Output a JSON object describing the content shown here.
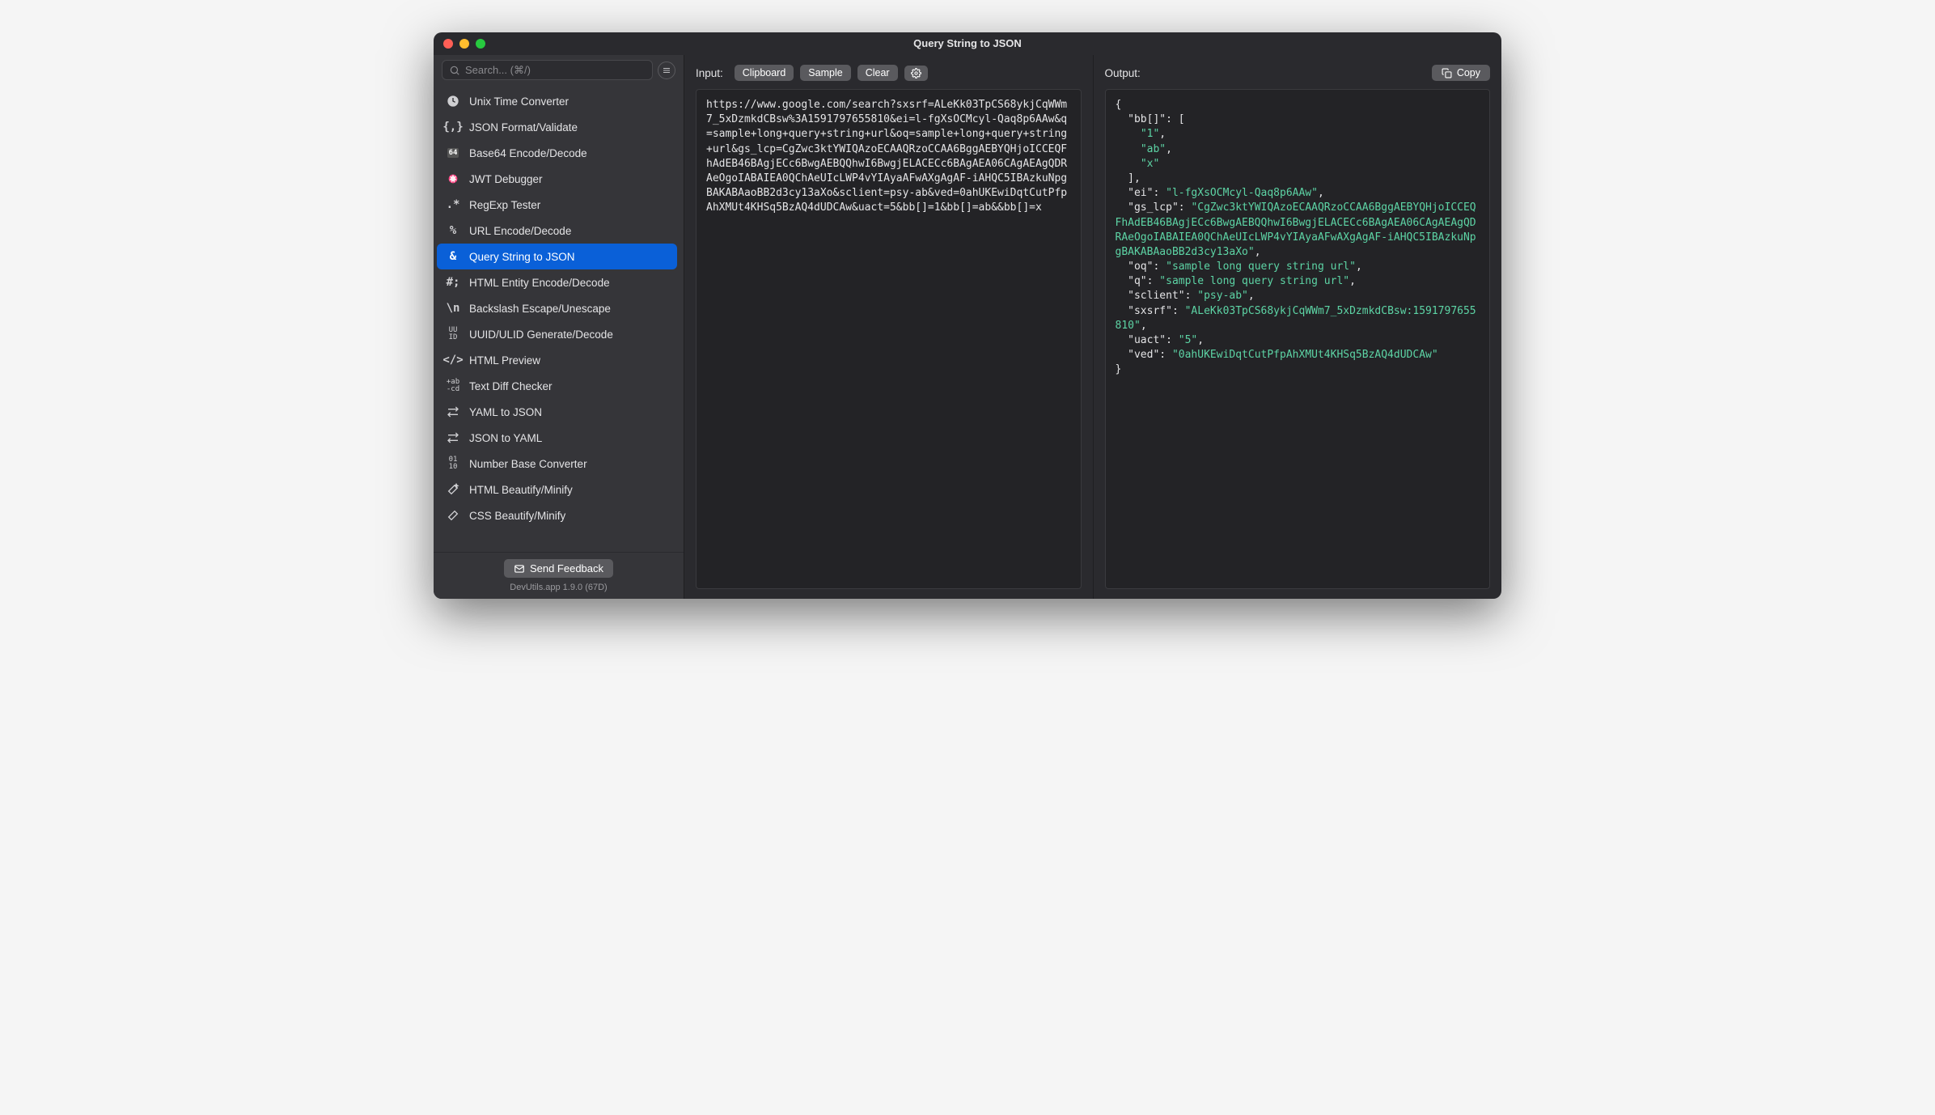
{
  "title": "Query String to JSON",
  "search": {
    "placeholder": "Search... (⌘/)"
  },
  "sidebar": {
    "tools": [
      {
        "label": "Unix Time Converter",
        "icon": "clock"
      },
      {
        "label": "JSON Format/Validate",
        "icon": "braces"
      },
      {
        "label": "Base64 Encode/Decode",
        "icon": "b64"
      },
      {
        "label": "JWT Debugger",
        "icon": "jwt"
      },
      {
        "label": "RegExp Tester",
        "icon": "regex"
      },
      {
        "label": "URL Encode/Decode",
        "icon": "percent"
      },
      {
        "label": "Query String to JSON",
        "icon": "amp",
        "active": true
      },
      {
        "label": "HTML Entity Encode/Decode",
        "icon": "hash"
      },
      {
        "label": "Backslash Escape/Unescape",
        "icon": "bslash"
      },
      {
        "label": "UUID/ULID Generate/Decode",
        "icon": "uuid"
      },
      {
        "label": "HTML Preview",
        "icon": "tag"
      },
      {
        "label": "Text Diff Checker",
        "icon": "textdiff"
      },
      {
        "label": "YAML to JSON",
        "icon": "swap"
      },
      {
        "label": "JSON to YAML",
        "icon": "swap"
      },
      {
        "label": "Number Base Converter",
        "icon": "bits"
      },
      {
        "label": "HTML Beautify/Minify",
        "icon": "wand"
      },
      {
        "label": "CSS Beautify/Minify",
        "icon": "wand2"
      }
    ],
    "feedback": "Send Feedback",
    "version": "DevUtils.app 1.9.0 (67D)"
  },
  "input": {
    "label": "Input:",
    "buttons": {
      "clipboard": "Clipboard",
      "sample": "Sample",
      "clear": "Clear"
    },
    "text": "https://www.google.com/search?sxsrf=ALeKk03TpCS68ykjCqWWm7_5xDzmkdCBsw%3A1591797655810&ei=l-fgXsOCMcyl-Qaq8p6AAw&q=sample+long+query+string+url&oq=sample+long+query+string+url&gs_lcp=CgZwc3ktYWIQAzoECAAQRzoCCAA6BggAEBYQHjoICCEQFhAdEB46BAgjECc6BwgAEBQQhwI6BwgjELACECc6BAgAEA06CAgAEAgQDRAeOgoIABAIEA0QChAeUIcLWP4vYIAyaAFwAXgAgAF-iAHQC5IBAzkuNpgBAKABAaoBB2d3cy13aXo&sclient=psy-ab&ved=0ahUKEwiDqtCutPfpAhXMUt4KHSq5BzAQ4dUDCAw&uact=5&bb[]=1&bb[]=ab&&bb[]=x"
  },
  "output": {
    "label": "Output:",
    "copy": "Copy",
    "json_tokens": [
      {
        "t": "punc",
        "v": "{\n"
      },
      {
        "t": "punc",
        "v": "  "
      },
      {
        "t": "key",
        "v": "\"bb[]\""
      },
      {
        "t": "punc",
        "v": ": [\n"
      },
      {
        "t": "punc",
        "v": "    "
      },
      {
        "t": "str",
        "v": "\"1\""
      },
      {
        "t": "punc",
        "v": ",\n"
      },
      {
        "t": "punc",
        "v": "    "
      },
      {
        "t": "str",
        "v": "\"ab\""
      },
      {
        "t": "punc",
        "v": ",\n"
      },
      {
        "t": "punc",
        "v": "    "
      },
      {
        "t": "str",
        "v": "\"x\""
      },
      {
        "t": "punc",
        "v": "\n"
      },
      {
        "t": "punc",
        "v": "  ],\n"
      },
      {
        "t": "punc",
        "v": "  "
      },
      {
        "t": "key",
        "v": "\"ei\""
      },
      {
        "t": "punc",
        "v": ": "
      },
      {
        "t": "str",
        "v": "\"l-fgXsOCMcyl-Qaq8p6AAw\""
      },
      {
        "t": "punc",
        "v": ",\n"
      },
      {
        "t": "punc",
        "v": "  "
      },
      {
        "t": "key",
        "v": "\"gs_lcp\""
      },
      {
        "t": "punc",
        "v": ": "
      },
      {
        "t": "str",
        "v": "\"CgZwc3ktYWIQAzoECAAQRzoCCAA6BggAEBYQHjoICCEQFhAdEB46BAgjECc6BwgAEBQQhwI6BwgjELACECc6BAgAEA06CAgAEAgQDRAeOgoIABAIEA0QChAeUIcLWP4vYIAyaAFwAXgAgAF-iAHQC5IBAzkuNpgBAKABAaoBB2d3cy13aXo\""
      },
      {
        "t": "punc",
        "v": ",\n"
      },
      {
        "t": "punc",
        "v": "  "
      },
      {
        "t": "key",
        "v": "\"oq\""
      },
      {
        "t": "punc",
        "v": ": "
      },
      {
        "t": "str",
        "v": "\"sample long query string url\""
      },
      {
        "t": "punc",
        "v": ",\n"
      },
      {
        "t": "punc",
        "v": "  "
      },
      {
        "t": "key",
        "v": "\"q\""
      },
      {
        "t": "punc",
        "v": ": "
      },
      {
        "t": "str",
        "v": "\"sample long query string url\""
      },
      {
        "t": "punc",
        "v": ",\n"
      },
      {
        "t": "punc",
        "v": "  "
      },
      {
        "t": "key",
        "v": "\"sclient\""
      },
      {
        "t": "punc",
        "v": ": "
      },
      {
        "t": "str",
        "v": "\"psy-ab\""
      },
      {
        "t": "punc",
        "v": ",\n"
      },
      {
        "t": "punc",
        "v": "  "
      },
      {
        "t": "key",
        "v": "\"sxsrf\""
      },
      {
        "t": "punc",
        "v": ": "
      },
      {
        "t": "str",
        "v": "\"ALeKk03TpCS68ykjCqWWm7_5xDzmkdCBsw:1591797655810\""
      },
      {
        "t": "punc",
        "v": ",\n"
      },
      {
        "t": "punc",
        "v": "  "
      },
      {
        "t": "key",
        "v": "\"uact\""
      },
      {
        "t": "punc",
        "v": ": "
      },
      {
        "t": "str",
        "v": "\"5\""
      },
      {
        "t": "punc",
        "v": ",\n"
      },
      {
        "t": "punc",
        "v": "  "
      },
      {
        "t": "key",
        "v": "\"ved\""
      },
      {
        "t": "punc",
        "v": ": "
      },
      {
        "t": "str",
        "v": "\"0ahUKEwiDqtCutPfpAhXMUt4KHSq5BzAQ4dUDCAw\""
      },
      {
        "t": "punc",
        "v": "\n"
      },
      {
        "t": "punc",
        "v": "}"
      }
    ]
  }
}
